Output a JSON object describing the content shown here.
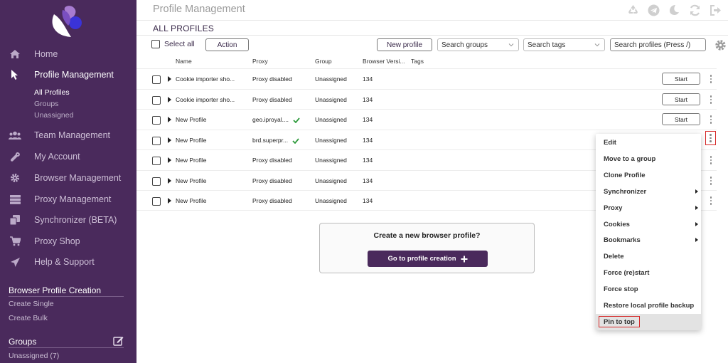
{
  "header": {
    "title": "Profile Management"
  },
  "sidebar": {
    "nav": [
      {
        "label": "Home"
      },
      {
        "label": "Profile Management"
      },
      {
        "label": "Team Management"
      },
      {
        "label": "My Account"
      },
      {
        "label": "Browser Management"
      },
      {
        "label": "Proxy Management"
      },
      {
        "label": "Synchronizer (BETA)"
      },
      {
        "label": "Proxy Shop"
      },
      {
        "label": "Help & Support"
      }
    ],
    "sub": [
      "All Profiles",
      "Groups",
      "Unassigned"
    ],
    "creation": {
      "title": "Browser Profile Creation",
      "links": [
        "Create Single",
        "Create Bulk"
      ]
    },
    "groups": {
      "title": "Groups",
      "items": [
        "Unassigned (7)"
      ]
    }
  },
  "main": {
    "heading": "ALL PROFILES",
    "toolbar": {
      "select_all": "Select all",
      "action": "Action",
      "new_profile": "New profile",
      "search_groups": "Search groups",
      "search_tags": "Search tags",
      "search_profiles": "Search profiles (Press /)"
    },
    "columns": [
      "Name",
      "Proxy",
      "Group",
      "Browser Versi...",
      "Tags"
    ],
    "rows": [
      {
        "name": "Cookie importer sho...",
        "proxy": "Proxy disabled",
        "group": "Unassigned",
        "version": "134",
        "start": "Start"
      },
      {
        "name": "Cookie importer sho...",
        "proxy": "Proxy disabled",
        "group": "Unassigned",
        "version": "134",
        "start": "Start"
      },
      {
        "name": "New Profile",
        "proxy": "geo.iproyal....",
        "group": "Unassigned",
        "version": "134",
        "start": "Start"
      },
      {
        "name": "New Profile",
        "proxy": "brd.superpr...",
        "group": "Unassigned",
        "version": "134",
        "start": ""
      },
      {
        "name": "New Profile",
        "proxy": "Proxy disabled",
        "group": "Unassigned",
        "version": "134",
        "start": ""
      },
      {
        "name": "New Profile",
        "proxy": "Proxy disabled",
        "group": "Unassigned",
        "version": "134",
        "start": ""
      },
      {
        "name": "New Profile",
        "proxy": "Proxy disabled",
        "group": "Unassigned",
        "version": "134",
        "start": ""
      }
    ],
    "create_card": {
      "title": "Create a new browser profile?",
      "button": "Go to profile creation"
    }
  },
  "context_menu": {
    "items": [
      "Edit",
      "Move to a group",
      "Clone Profile",
      "Synchronizer",
      "Proxy",
      "Cookies",
      "Bookmarks",
      "Delete",
      "Force (re)start",
      "Force stop",
      "Restore local profile backup",
      "Pin to top"
    ]
  },
  "colors": {
    "sidebar": "#4a2a5c",
    "accent": "#4a2a5c",
    "highlight": "#d62828",
    "proxy_ok": "#2e9a3c"
  }
}
